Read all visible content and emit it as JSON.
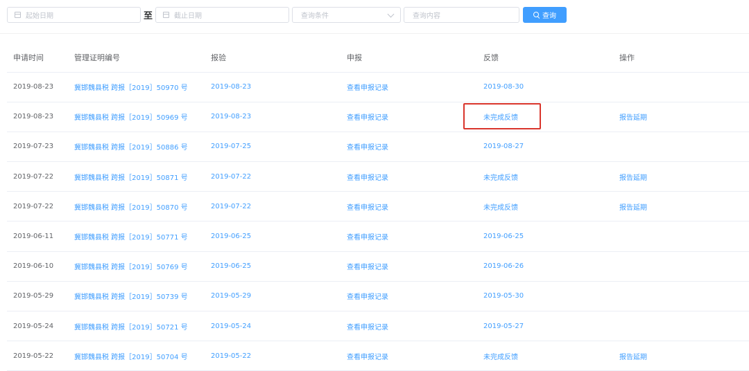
{
  "filters": {
    "start_date_placeholder": "起始日期",
    "to_label": "至",
    "end_date_placeholder": "截止日期",
    "condition_placeholder": "查询条件",
    "content_placeholder": "查询内容",
    "search_label": "查询"
  },
  "table": {
    "columns": [
      "申请时间",
      "管理证明编号",
      "报验",
      "申报",
      "反馈",
      "操作"
    ],
    "rows": [
      {
        "apply": "2019-08-23",
        "cert": "冀邯魏县税 跨报［2019］50970 号",
        "inspect": "2019-08-23",
        "declare": "查看申报记录",
        "feedback": "2019-08-30",
        "action": ""
      },
      {
        "apply": "2019-08-23",
        "cert": "冀邯魏县税 跨报［2019］50969 号",
        "inspect": "2019-08-23",
        "declare": "查看申报记录",
        "feedback": "未完成反馈",
        "action": "报告延期"
      },
      {
        "apply": "2019-07-23",
        "cert": "冀邯魏县税 跨报［2019］50886 号",
        "inspect": "2019-07-25",
        "declare": "查看申报记录",
        "feedback": "2019-08-27",
        "action": ""
      },
      {
        "apply": "2019-07-22",
        "cert": "冀邯魏县税 跨报［2019］50871 号",
        "inspect": "2019-07-22",
        "declare": "查看申报记录",
        "feedback": "未完成反馈",
        "action": "报告延期"
      },
      {
        "apply": "2019-07-22",
        "cert": "冀邯魏县税 跨报［2019］50870 号",
        "inspect": "2019-07-22",
        "declare": "查看申报记录",
        "feedback": "未完成反馈",
        "action": "报告延期"
      },
      {
        "apply": "2019-06-11",
        "cert": "冀邯魏县税 跨报［2019］50771 号",
        "inspect": "2019-06-25",
        "declare": "查看申报记录",
        "feedback": "2019-06-25",
        "action": ""
      },
      {
        "apply": "2019-06-10",
        "cert": "冀邯魏县税 跨报［2019］50769 号",
        "inspect": "2019-06-25",
        "declare": "查看申报记录",
        "feedback": "2019-06-26",
        "action": ""
      },
      {
        "apply": "2019-05-29",
        "cert": "冀邯魏县税 跨报［2019］50739 号",
        "inspect": "2019-05-29",
        "declare": "查看申报记录",
        "feedback": "2019-05-30",
        "action": ""
      },
      {
        "apply": "2019-05-24",
        "cert": "冀邯魏县税 跨报［2019］50721 号",
        "inspect": "2019-05-24",
        "declare": "查看申报记录",
        "feedback": "2019-05-27",
        "action": ""
      },
      {
        "apply": "2019-05-22",
        "cert": "冀邯魏县税 跨报［2019］50704 号",
        "inspect": "2019-05-22",
        "declare": "查看申报记录",
        "feedback": "未完成反馈",
        "action": "报告延期"
      }
    ]
  },
  "colors": {
    "primary": "#409eff",
    "highlight": "#d9342b"
  },
  "icons": {
    "date": "calendar-icon",
    "select": "chevron-down-icon",
    "search": "search-icon"
  }
}
